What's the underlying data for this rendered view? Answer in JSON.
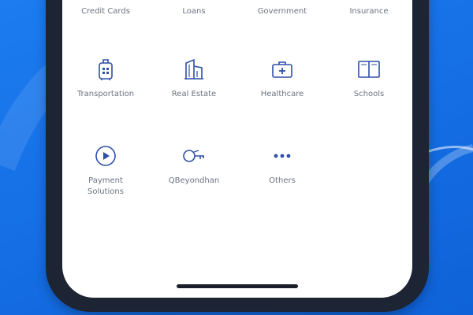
{
  "colors": {
    "background": "#1670e6",
    "frame": "#1d2433",
    "screen": "#ffffff",
    "icon": "#2f4fa8",
    "label": "#6b7280"
  },
  "categories": [
    {
      "label": "Credit Cards",
      "icon": "credit-card-icon"
    },
    {
      "label": "Loans",
      "icon": "loan-icon"
    },
    {
      "label": "Government",
      "icon": "government-icon"
    },
    {
      "label": "Insurance",
      "icon": "insurance-icon"
    },
    {
      "label": "Transportation",
      "icon": "luggage-icon"
    },
    {
      "label": "Real Estate",
      "icon": "building-icon"
    },
    {
      "label": "Healthcare",
      "icon": "medical-kit-icon"
    },
    {
      "label": "Schools",
      "icon": "book-icon"
    },
    {
      "label": "Payment\nSolutions",
      "icon": "payment-icon"
    },
    {
      "label": "QBeyondhan",
      "icon": "key-icon"
    },
    {
      "label": "Others",
      "icon": "more-dots-icon"
    }
  ]
}
